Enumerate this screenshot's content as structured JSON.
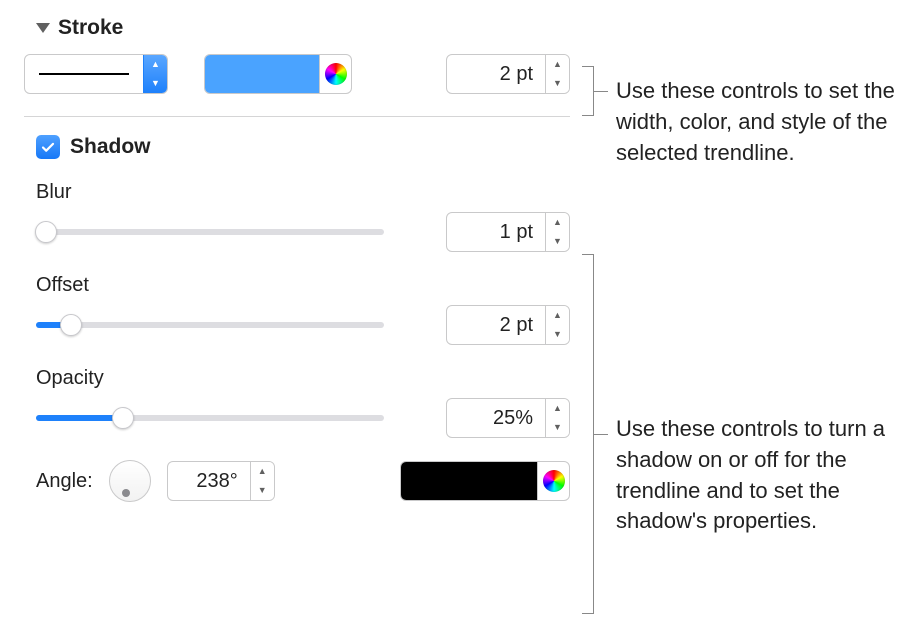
{
  "stroke": {
    "title": "Stroke",
    "color": "#4aa3ff",
    "width_text": "2 pt"
  },
  "shadow": {
    "title": "Shadow",
    "checked": true,
    "blur": {
      "label": "Blur",
      "value_text": "1 pt",
      "fill_pct": 3,
      "thumb_pct": 3
    },
    "offset": {
      "label": "Offset",
      "value_text": "2 pt",
      "fill_pct": 10,
      "thumb_pct": 10
    },
    "opacity": {
      "label": "Opacity",
      "value_text": "25%",
      "fill_pct": 25,
      "thumb_pct": 25
    },
    "angle": {
      "label": "Angle:",
      "value_text": "238°"
    },
    "shadow_color": "#000000"
  },
  "callouts": {
    "stroke": "Use these controls to set the width, color, and style of the selected trendline.",
    "shadow": "Use these controls to turn a shadow on or off for the trendline and to set the shadow's properties."
  }
}
